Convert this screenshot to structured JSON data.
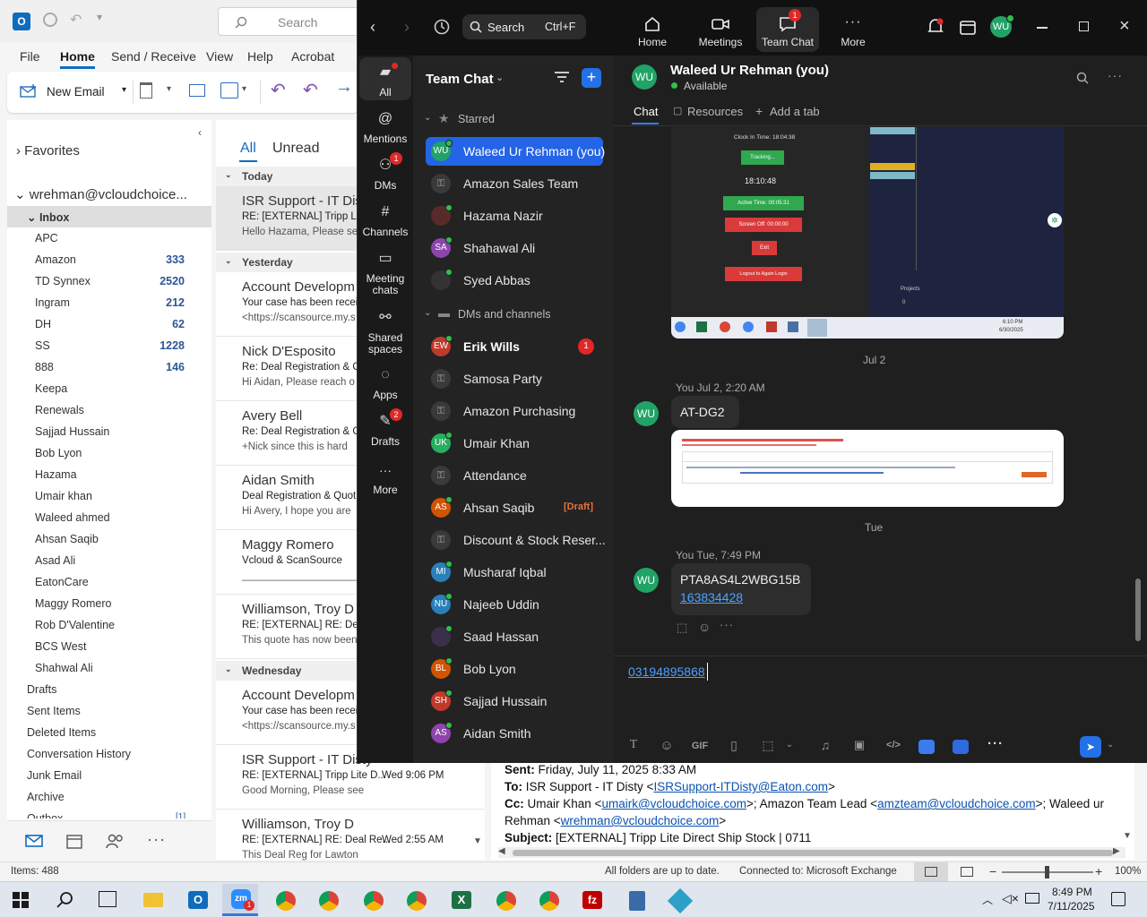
{
  "outlook": {
    "search_placeholder": "Search",
    "menu": [
      "File",
      "Home",
      "Send / Receive",
      "View",
      "Help",
      "Acrobat"
    ],
    "ribbon": {
      "new_email": "New Email"
    },
    "nav": {
      "favorites": "Favorites",
      "account": "wrehman@vcloudchoice...",
      "inbox": "Inbox",
      "folders": [
        {
          "name": "APC",
          "count": ""
        },
        {
          "name": "Amazon",
          "count": "333"
        },
        {
          "name": "TD Synnex",
          "count": "2520"
        },
        {
          "name": "Ingram",
          "count": "212"
        },
        {
          "name": "DH",
          "count": "62"
        },
        {
          "name": "SS",
          "count": "1228"
        },
        {
          "name": "888",
          "count": "146"
        },
        {
          "name": "Keepa",
          "count": ""
        },
        {
          "name": "Renewals",
          "count": ""
        },
        {
          "name": "Sajjad Hussain",
          "count": ""
        },
        {
          "name": "Bob Lyon",
          "count": ""
        },
        {
          "name": "Hazama",
          "count": ""
        },
        {
          "name": "Umair khan",
          "count": ""
        },
        {
          "name": "Waleed ahmed",
          "count": ""
        },
        {
          "name": "Ahsan Saqib",
          "count": ""
        },
        {
          "name": "Asad Ali",
          "count": ""
        },
        {
          "name": "EatonCare",
          "count": ""
        },
        {
          "name": "Maggy Romero",
          "count": ""
        },
        {
          "name": "Rob D'Valentine",
          "count": ""
        },
        {
          "name": "BCS West",
          "count": ""
        },
        {
          "name": "Shahwal Ali",
          "count": ""
        }
      ],
      "top_folders": [
        "Drafts",
        "Sent Items",
        "Deleted Items",
        "Conversation History",
        "Junk Email",
        "Archive",
        "Outbox"
      ],
      "outbox_count": "[1]"
    },
    "list": {
      "tab_all": "All",
      "tab_unread": "Unread",
      "groups": {
        "today": "Today",
        "yesterday": "Yesterday",
        "wednesday": "Wednesday"
      },
      "items": [
        {
          "from": "ISR Support - IT Dis",
          "subj": "RE: [EXTERNAL] Tripp Lite",
          "prev": "Hello Hazama,  Please see",
          "date": ""
        },
        {
          "from": "Account Developm",
          "subj": "Your case has been recei",
          "prev": "<https://scansource.my.s",
          "date": ""
        },
        {
          "from": "Nick D'Esposito",
          "subj": "Re: Deal Registration & C",
          "prev": "Hi Aidan,  Please reach o",
          "date": ""
        },
        {
          "from": "Avery Bell",
          "subj": "Re: Deal Registration & C",
          "prev": "+Nick since this is hard",
          "date": ""
        },
        {
          "from": "Aidan Smith",
          "subj": "Deal Registration & Quot",
          "prev": "Hi Avery,  I hope you are",
          "date": ""
        },
        {
          "from": "Maggy Romero",
          "subj": "Vcloud & ScanSource",
          "prev": "______________________",
          "date": ""
        },
        {
          "from": "Williamson, Troy D",
          "subj": "RE: [EXTERNAL] RE: Deal R",
          "prev": "This quote has now been",
          "date": ""
        },
        {
          "from": "Account Developm",
          "subj": "Your case has been recei",
          "prev": "<https://scansource.my.s",
          "date": ""
        },
        {
          "from": "ISR Support - IT Disty",
          "subj": "RE: [EXTERNAL] Tripp Lite D...",
          "prev": "Good Morning,  Please see",
          "date": "Wed 9:06 PM"
        },
        {
          "from": "Williamson, Troy D",
          "subj": "RE: [EXTERNAL] RE: Deal Re...",
          "prev": "This Deal Reg for Lawton",
          "date": "Wed 2:55 AM"
        }
      ]
    },
    "reading": {
      "sent_label": "Sent:",
      "sent": "Friday, July 11, 2025 8:33 AM",
      "to_label": "To:",
      "to": "ISR Support - IT Disty <",
      "to_link": "ISRSupport-ITDisty@Eaton.com",
      "to_end": ">",
      "cc_label": "Cc:",
      "cc1": "Umair Khan <",
      "cc1_link": "umairk@vcloudchoice.com",
      "cc2": ">; Amazon Team Lead <",
      "cc2_link": "amzteam@vcloudchoice.com",
      "cc3": ">; Waleed ur",
      "cc4": "Rehman <",
      "cc4_link": "wrehman@vcloudchoice.com",
      "cc5": ">",
      "subject_label": "Subject:",
      "subject": "[EXTERNAL] Tripp Lite Direct Ship Stock | 0711"
    },
    "status": {
      "items": "Items: 488",
      "sync": "All folders are up to date.",
      "conn": "Connected to: Microsoft Exchange",
      "zoom": "100%"
    }
  },
  "zoom": {
    "search": "Search",
    "shortcut": "Ctrl+F",
    "tabs": [
      {
        "label": "Home"
      },
      {
        "label": "Meetings"
      },
      {
        "label": "Team Chat",
        "badge": "1"
      },
      {
        "label": "More"
      }
    ],
    "rail": [
      {
        "label": "All"
      },
      {
        "label": "Mentions"
      },
      {
        "label": "DMs",
        "badge": "1"
      },
      {
        "label": "Channels"
      },
      {
        "label": "Meeting chats"
      },
      {
        "label": "Shared spaces"
      },
      {
        "label": "Apps"
      },
      {
        "label": "Drafts",
        "badge": "2"
      },
      {
        "label": "More"
      }
    ],
    "sidebar": {
      "title": "Team Chat",
      "starred": "Starred",
      "dms": "DMs and channels",
      "starred_items": [
        {
          "name": "Waleed Ur Rehman (you)",
          "initials": "WU",
          "color": "#21a366"
        },
        {
          "name": "Amazon Sales Team",
          "initials": "",
          "color": ""
        },
        {
          "name": "Hazama Nazir",
          "initials": "",
          "color": "#5a2a2a"
        },
        {
          "name": "Shahawal Ali",
          "initials": "SA",
          "color": "#8e44ad"
        },
        {
          "name": "Syed Abbas",
          "initials": "",
          "color": "#333"
        }
      ],
      "dm_items": [
        {
          "name": "Erik Wills",
          "initials": "EW",
          "color": "#c0392b",
          "badge": "1"
        },
        {
          "name": "Samosa Party",
          "initials": "",
          "color": ""
        },
        {
          "name": "Amazon Purchasing",
          "initials": "",
          "color": ""
        },
        {
          "name": "Umair Khan",
          "initials": "UK",
          "color": "#27ae60"
        },
        {
          "name": "Attendance",
          "initials": "",
          "color": ""
        },
        {
          "name": "Ahsan Saqib",
          "initials": "AS",
          "color": "#d35400",
          "tag": "[Draft]"
        },
        {
          "name": "Discount & Stock Reser...",
          "initials": "",
          "color": ""
        },
        {
          "name": "Musharaf Iqbal",
          "initials": "MI",
          "color": "#2980b9"
        },
        {
          "name": "Najeeb Uddin",
          "initials": "NU",
          "color": "#2980b9"
        },
        {
          "name": "Saad Hassan",
          "initials": "",
          "color": "#3b2f4a"
        },
        {
          "name": "Bob Lyon",
          "initials": "BL",
          "color": "#d35400"
        },
        {
          "name": "Sajjad Hussain",
          "initials": "SH",
          "color": "#c0392b"
        },
        {
          "name": "Aidan Smith",
          "initials": "AS",
          "color": "#8e44ad"
        }
      ]
    },
    "chat": {
      "name": "Waleed Ur Rehman (you)",
      "initials": "WU",
      "status": "Available",
      "tab_chat": "Chat",
      "tab_resources": "Resources",
      "add_tab": "Add a tab",
      "date1": "Jul 2",
      "date2": "Tue",
      "msg1_meta": "You Jul 2, 2:20 AM",
      "msg1_text": "AT-DG2",
      "msg2_meta": "You Tue, 7:49 PM",
      "msg2_text": "PTA8AS4L2WBG15B",
      "msg2_link": "163834428",
      "compose": "03194895868",
      "shot": {
        "clock_in": "Clock In Time: 18:04:38",
        "tracking": "Tracking...",
        "time": "18:10:48",
        "active": "Active Time: 00:05:31",
        "screen_off": "Screen Off: 00:00:00",
        "exit": "Exit",
        "logout": "Logout to Again Login",
        "projects": "Projects",
        "projects_val": "0",
        "clock": "6:10 PM",
        "date": "6/30/2025"
      }
    }
  },
  "taskbar": {
    "time": "8:49 PM",
    "date": "7/11/2025"
  }
}
